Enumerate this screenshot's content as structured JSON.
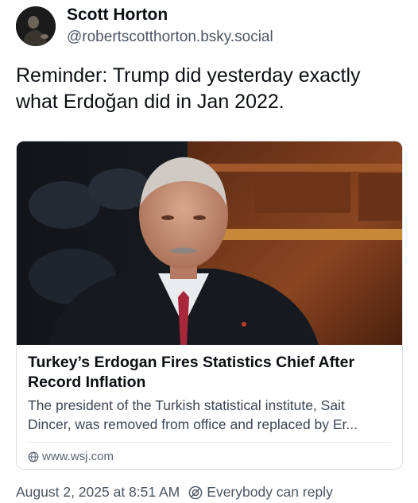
{
  "author": {
    "display_name": "Scott Horton",
    "handle": "@robertscotthorton.bsky.social"
  },
  "post": {
    "text": "Reminder: Trump did yesterday exactly what Erdoğan did in Jan 2022."
  },
  "link_card": {
    "title": "Turkey’s Erdogan Fires Statistics Chief After Record Inflation",
    "description": "The president of the Turkish statistical institute, Sait Dincer, was removed from office and replaced by Er...",
    "domain": "www.wsj.com"
  },
  "footer": {
    "timestamp": "August 2, 2025 at 8:51 AM",
    "reply_setting": "Everybody can reply"
  },
  "icons": {
    "globe": "globe-icon",
    "reply": "reply-settings-icon"
  },
  "colors": {
    "text": "#0b0f14",
    "muted": "#4a5563",
    "border": "#d8dee5"
  }
}
